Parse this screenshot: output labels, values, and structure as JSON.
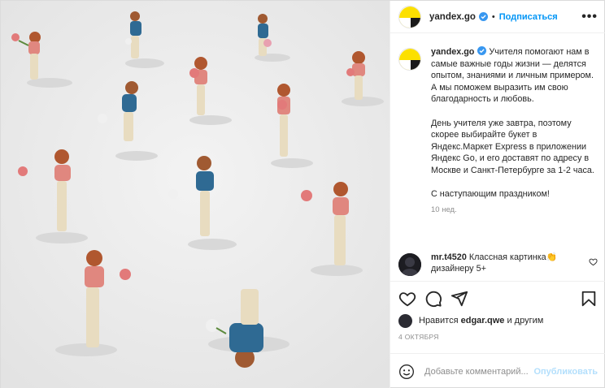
{
  "header": {
    "username": "yandex.go",
    "separator": "•",
    "follow_label": "Подписаться",
    "more_label": "•••"
  },
  "caption": {
    "username": "yandex.go",
    "paragraph1": "Учителя помогают нам в самые важные годы жизни — делятся опытом, знаниями и личным примером. А мы поможем выразить им свою благодарность и любовь.",
    "paragraph2": "День учителя уже завтра, поэтому скорее выбирайте букет в Яндекс.Маркет Express в приложении Яндекс Go, и его доставят по адресу в Москве и Санкт-Петербурге за 1-2 часа.",
    "paragraph3": "С наступающим праздником!",
    "time": "10 нед."
  },
  "comment": {
    "username": "mr.t4520",
    "text": "Классная картинка👏 дизайнеру 5+"
  },
  "likes": {
    "prefix": "Нравится",
    "user": "edgar.qwe",
    "suffix": "и другим"
  },
  "date": "4 ОКТЯБРЯ",
  "add_comment": {
    "placeholder": "Добавьте комментарий...",
    "publish_label": "Опубликовать"
  },
  "icons": {
    "verified": "verified-badge-icon",
    "heart": "heart-icon",
    "comment": "comment-icon",
    "share": "share-icon",
    "bookmark": "bookmark-icon",
    "emoji": "emoji-icon"
  },
  "colors": {
    "accent": "#0095f6",
    "brand_yellow": "#fce000",
    "text": "#262626",
    "muted": "#8e8e8e",
    "photo_bg": "#ececec"
  }
}
